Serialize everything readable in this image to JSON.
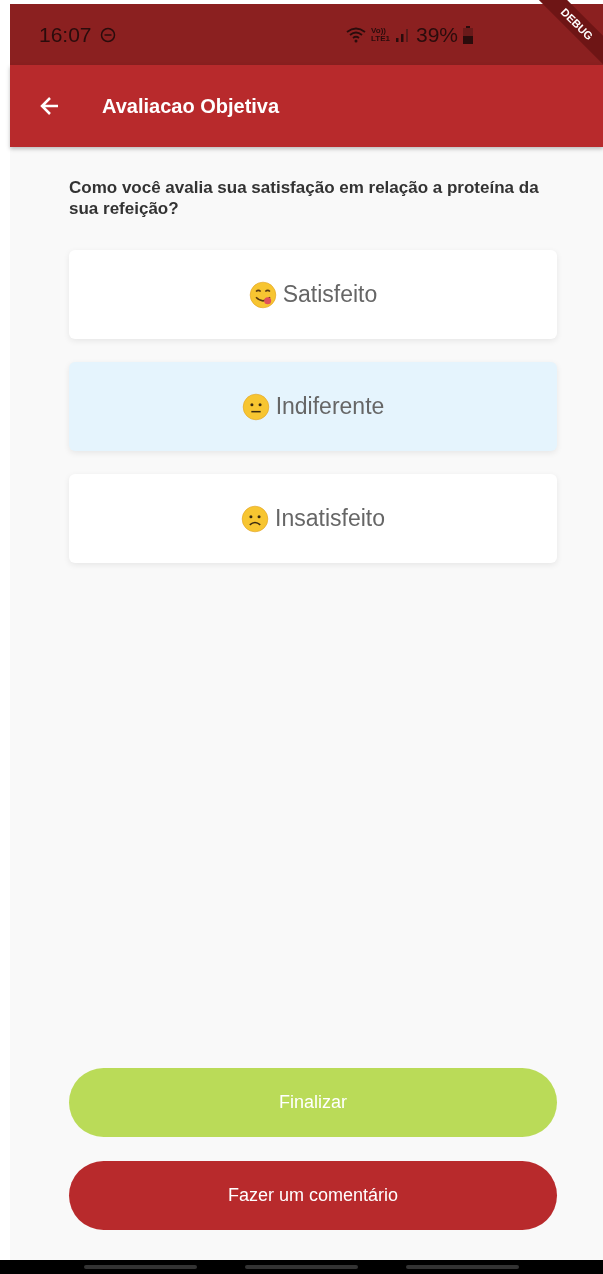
{
  "status_bar": {
    "time": "16:07",
    "battery": "39%",
    "network": "LTE1",
    "voice": "Vo))"
  },
  "debug_banner": "DEBUG",
  "app_bar": {
    "title": "Avaliacao Objetiva"
  },
  "question": "Como você avalia sua satisfação em relação a proteína da sua refeição?",
  "options": [
    {
      "label": "Satisfeito",
      "kind": "yum",
      "selected": false
    },
    {
      "label": "Indiferente",
      "kind": "neutral",
      "selected": true
    },
    {
      "label": "Insatisfeito",
      "kind": "sad",
      "selected": false
    }
  ],
  "buttons": [
    {
      "label": "Finalizar",
      "kind": "primary"
    },
    {
      "label": "Fazer um comentário",
      "kind": "secondary"
    }
  ]
}
